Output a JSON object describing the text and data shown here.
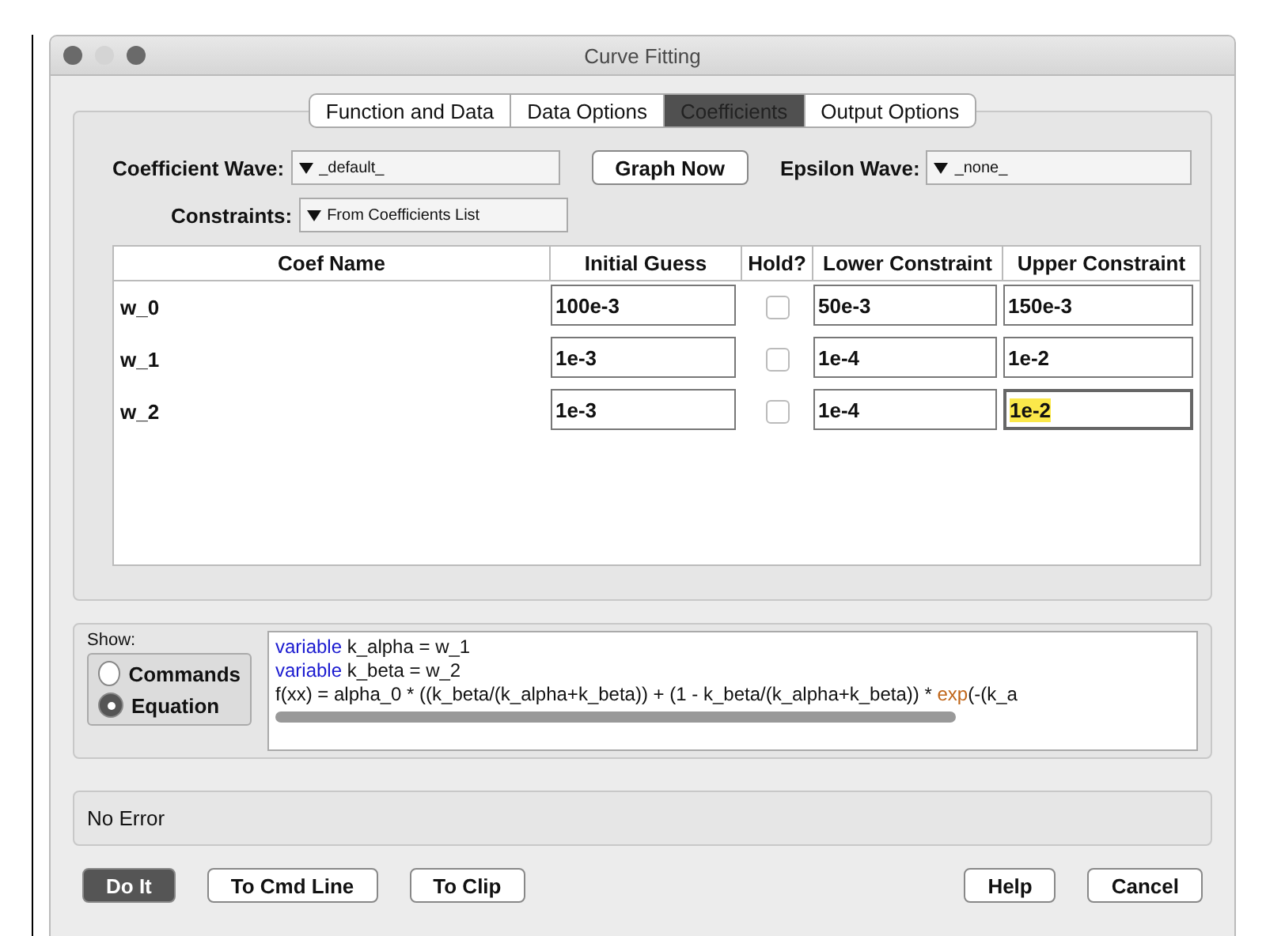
{
  "window": {
    "title": "Curve Fitting"
  },
  "tabs": [
    {
      "label": "Function and Data",
      "selected": false
    },
    {
      "label": "Data Options",
      "selected": false
    },
    {
      "label": "Coefficients",
      "selected": true
    },
    {
      "label": "Output Options",
      "selected": false
    }
  ],
  "coefficient_wave": {
    "label": "Coefficient Wave:",
    "value": "_default_"
  },
  "graph_now_button": "Graph Now",
  "epsilon_wave": {
    "label": "Epsilon Wave:",
    "value": "_none_"
  },
  "constraints": {
    "label": "Constraints:",
    "value": "From Coefficients List"
  },
  "table": {
    "columns": [
      "Coef Name",
      "Initial Guess",
      "Hold?",
      "Lower Constraint",
      "Upper Constraint"
    ],
    "rows": [
      {
        "name": "w_0",
        "initial_guess": "100e-3",
        "hold": false,
        "lower": "50e-3",
        "upper": "150e-3",
        "focused": false
      },
      {
        "name": "w_1",
        "initial_guess": "1e-3",
        "hold": false,
        "lower": "1e-4",
        "upper": "1e-2",
        "focused": false
      },
      {
        "name": "w_2",
        "initial_guess": "1e-3",
        "hold": false,
        "lower": "1e-4",
        "upper": "1e-2",
        "focused": true
      }
    ]
  },
  "show": {
    "label": "Show:",
    "options": [
      {
        "label": "Commands",
        "selected": false
      },
      {
        "label": "Equation",
        "selected": true
      }
    ]
  },
  "code_lines": [
    [
      {
        "kind": "keyword",
        "text": "variable"
      },
      {
        "kind": "plain",
        "text": " k_alpha = w_1"
      }
    ],
    [
      {
        "kind": "keyword",
        "text": "variable"
      },
      {
        "kind": "plain",
        "text": " k_beta = w_2"
      }
    ],
    [
      {
        "kind": "plain",
        "text": "f(xx) = alpha_0 *  ((k_beta/(k_alpha+k_beta)) +  (1 - k_beta/(k_alpha+k_beta)) * "
      },
      {
        "kind": "function",
        "text": "exp"
      },
      {
        "kind": "plain",
        "text": "(-(k_a"
      }
    ]
  ],
  "status": "No Error",
  "buttons": [
    {
      "label": "Do It",
      "primary": true
    },
    {
      "label": "To Cmd Line",
      "primary": false
    },
    {
      "label": "To Clip",
      "primary": false
    },
    {
      "label": "Help",
      "primary": false
    },
    {
      "label": "Cancel",
      "primary": false
    }
  ]
}
